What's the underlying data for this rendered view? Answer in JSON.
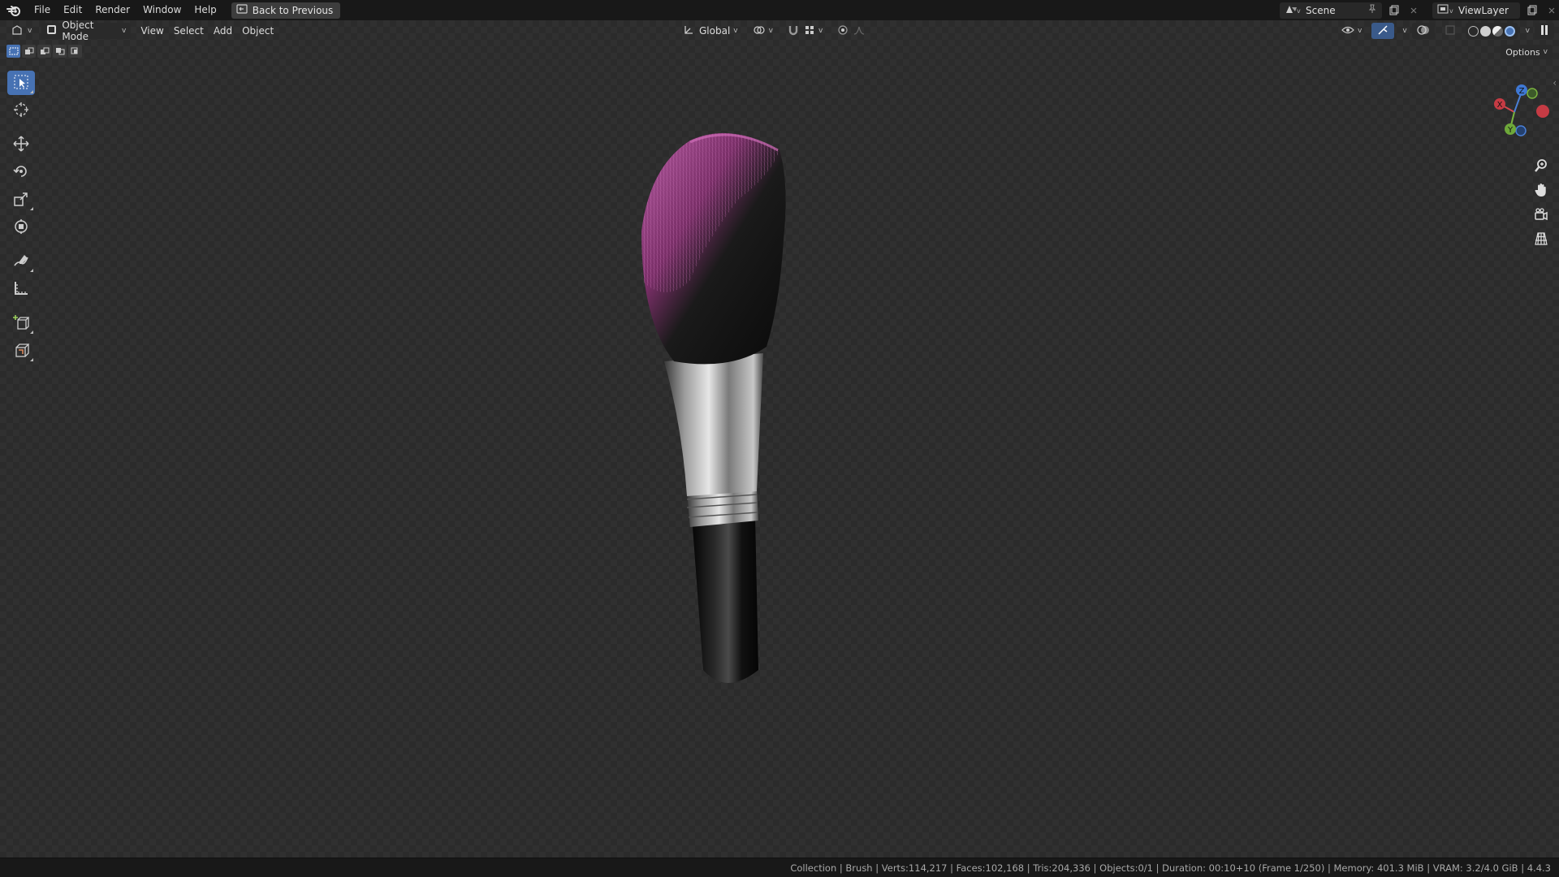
{
  "menubar": {
    "items": [
      "File",
      "Edit",
      "Render",
      "Window",
      "Help"
    ],
    "back_button": "Back to Previous",
    "scene": "Scene",
    "view_layer": "ViewLayer"
  },
  "viewport_header": {
    "mode": "Object Mode",
    "menus": [
      "View",
      "Select",
      "Add",
      "Object"
    ],
    "orientation": "Global",
    "options": "Options"
  },
  "gizmo": {
    "x": "X",
    "y": "Y",
    "z": "Z"
  },
  "statusbar": {
    "text": "Collection | Brush | Verts:114,217 | Faces:102,168 | Tris:204,336 | Objects:0/1 | Duration: 00:10+10 (Frame 1/250) | Memory: 401.3 MiB | VRAM: 3.2/4.0 GiB | 4.4.3"
  },
  "colors": {
    "accent": "#4772b3",
    "bristle_pink": "#a24a8e"
  }
}
